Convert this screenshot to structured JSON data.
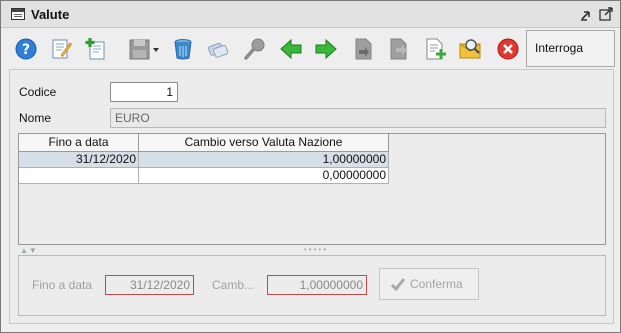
{
  "window": {
    "title": "Valute"
  },
  "toolbar": {
    "query_button_label": "Interroga",
    "icons": [
      "help-icon",
      "edit-icon",
      "new-icon",
      "save-icon",
      "delete-icon",
      "copy-icon",
      "search-icon",
      "previous-icon",
      "next-icon",
      "import-icon",
      "export-icon",
      "add-document-icon",
      "find-record-icon",
      "close-icon"
    ]
  },
  "form": {
    "codice": {
      "label": "Codice",
      "value": "1"
    },
    "nome": {
      "label": "Nome",
      "value": "EURO"
    }
  },
  "grid": {
    "columns": [
      "Fino a data",
      "Cambio verso Valuta Nazione"
    ],
    "rows": [
      [
        "31/12/2020",
        "1,00000000"
      ],
      [
        "",
        "0,00000000"
      ]
    ]
  },
  "detail": {
    "date_label": "Fino a data",
    "date_value": "31/12/2020",
    "rate_label": "Camb...",
    "rate_value": "1,00000000",
    "confirm_label": "Conferma"
  }
}
